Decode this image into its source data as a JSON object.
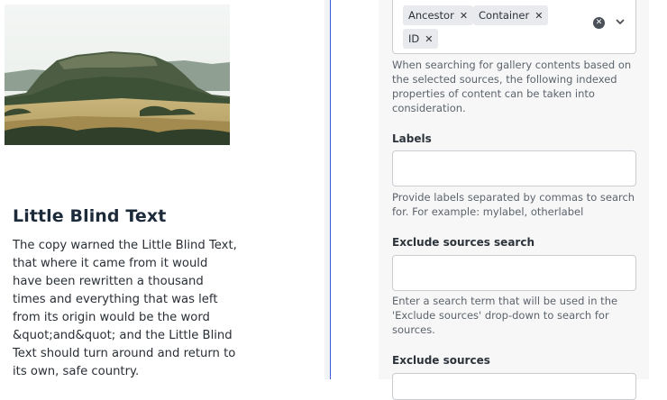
{
  "article": {
    "image_alt": "Landscape with a forested table mountain above golden fields",
    "title": "Little Blind Text",
    "body": "The copy warned the Little Blind Text, that where it came from it would have been rewritten a thousand times and everything that was left from its origin would be the word &quot;and&quot; and the Little Blind Text should turn around and return to its own, safe country."
  },
  "config": {
    "properties_tags": [
      "Ancestor",
      "Container",
      "ID"
    ],
    "properties_help": "When searching for gallery contents based on the selected sources, the following indexed properties of content can be taken into consideration.",
    "labels_label": "Labels",
    "labels_value": "",
    "labels_help": "Provide labels separated by commas to search for. For example: mylabel, otherlabel",
    "exclude_search_label": "Exclude sources search",
    "exclude_search_value": "",
    "exclude_search_help": "Enter a search term that will be used in the 'Exclude sources' drop-down to search for sources.",
    "exclude_sources_label": "Exclude sources"
  },
  "icons": {
    "remove_tag": "close-icon",
    "clear_all": "clear-circle-icon",
    "expand": "chevron-down-icon"
  },
  "colors": {
    "accent_divider": "#3b5bdb",
    "panel_bg": "#f7f7f8",
    "tag_bg": "#e9eaed"
  }
}
